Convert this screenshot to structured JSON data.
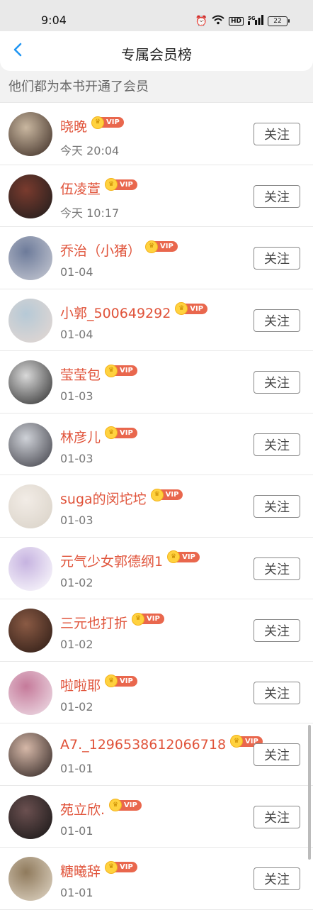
{
  "status": {
    "time": "9:04",
    "hd": "HD",
    "signal": "5G",
    "battery": "22"
  },
  "header": {
    "title": "专属会员榜",
    "back_icon": "chevron-left-icon"
  },
  "subtitle": "他们都为本书开通了会员",
  "vip_label": "VIP",
  "follow_label": "关注",
  "colors": {
    "name": "#e0533a",
    "vip_badge": "#e9674d",
    "crown": "#ffd23f",
    "back": "#2196f3"
  },
  "members": [
    {
      "name": "晓晚",
      "date": "今天 20:04"
    },
    {
      "name": "伍凌萱",
      "date": "今天 10:17"
    },
    {
      "name": "乔治（小猪）",
      "date": "01-04"
    },
    {
      "name": "小郭_500649292",
      "date": "01-04"
    },
    {
      "name": "莹莹包",
      "date": "01-03"
    },
    {
      "name": "林彦儿",
      "date": "01-03"
    },
    {
      "name": "suga的闵坨坨",
      "date": "01-03"
    },
    {
      "name": "元气少女郭德纲1",
      "date": "01-02"
    },
    {
      "name": "三元也打折",
      "date": "01-02"
    },
    {
      "name": "啦啦耶",
      "date": "01-02"
    },
    {
      "name": "A7._1296538612066718",
      "date": "01-01"
    },
    {
      "name": "苑立欣.",
      "date": "01-01"
    },
    {
      "name": "糖曦辞",
      "date": "01-01"
    }
  ]
}
